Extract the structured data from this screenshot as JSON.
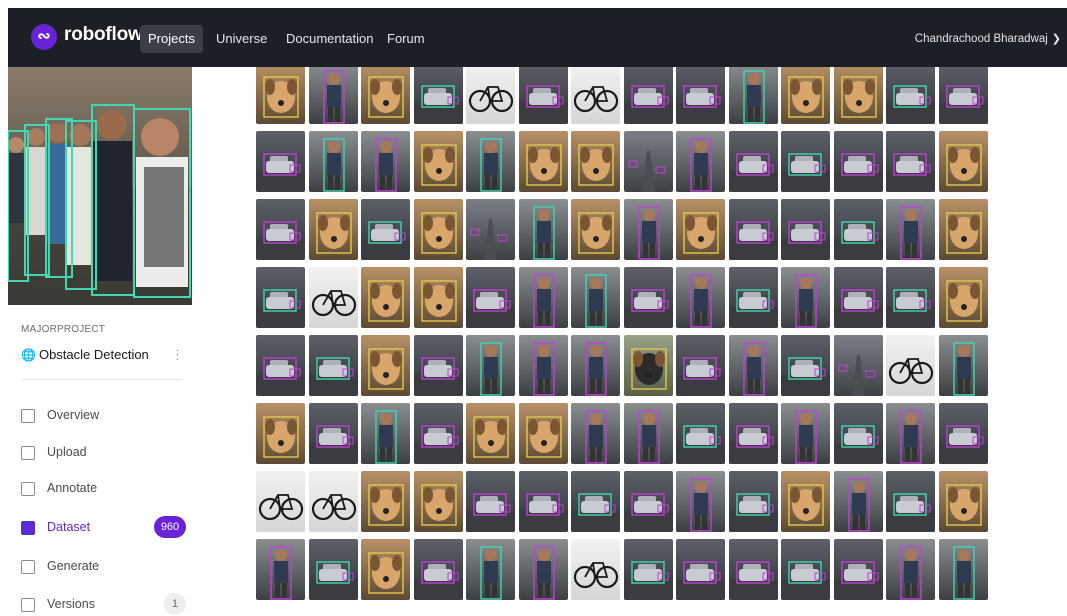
{
  "header": {
    "brand": "roboflow",
    "nav": [
      "Projects",
      "Universe",
      "Documentation",
      "Forum"
    ],
    "active_nav": "Projects",
    "user_name": "Chandrachood Bharadwaj"
  },
  "project": {
    "workspace": "MAJORPROJECT",
    "name": "Obstacle Detection"
  },
  "sidebar": {
    "items": [
      {
        "label": "Overview",
        "icon": "overview-icon"
      },
      {
        "label": "Upload",
        "icon": "upload-icon"
      },
      {
        "label": "Annotate",
        "icon": "annotate-icon"
      },
      {
        "label": "Dataset",
        "icon": "dataset-icon",
        "badge": "960",
        "active": true
      },
      {
        "label": "Generate",
        "icon": "generate-icon"
      },
      {
        "label": "Versions",
        "icon": "versions-icon",
        "badge": "1"
      }
    ]
  },
  "colors": {
    "topbar": "#1c1f26",
    "accent": "#6a22d8",
    "annotation_box": "#c040d8",
    "annotation_box_alt": "#3fd8b0"
  },
  "grid": {
    "rows": 8,
    "cols": 14,
    "thumbnails": [
      "dog",
      "person",
      "dog",
      "car",
      "bicycle",
      "car",
      "bicycle",
      "car",
      "car",
      "person",
      "dog",
      "dog",
      "car",
      "car",
      "car",
      "person",
      "person",
      "dog",
      "person",
      "dog",
      "dog",
      "road",
      "person",
      "car",
      "car",
      "car",
      "car",
      "dog",
      "car",
      "dog",
      "car",
      "dog",
      "road",
      "person",
      "dog",
      "person",
      "dog",
      "car",
      "car",
      "car",
      "person",
      "dog",
      "car",
      "bicycle",
      "dog",
      "dog",
      "car",
      "person",
      "person",
      "car",
      "person",
      "car",
      "person",
      "car",
      "car",
      "dog",
      "car",
      "car",
      "dog",
      "car",
      "person",
      "person",
      "person",
      "cow",
      "car",
      "person",
      "car",
      "road",
      "bicycle",
      "person",
      "dog",
      "car",
      "person",
      "car",
      "dog",
      "dog",
      "person",
      "person",
      "car",
      "car",
      "person",
      "car",
      "person",
      "car",
      "bicycle",
      "bicycle",
      "dog",
      "dog",
      "car",
      "car",
      "car",
      "car",
      "person",
      "car",
      "dog",
      "person",
      "car",
      "dog",
      "person",
      "car",
      "dog",
      "car",
      "person",
      "person",
      "bicycle",
      "car",
      "car",
      "car",
      "car",
      "car",
      "person",
      "person"
    ]
  }
}
